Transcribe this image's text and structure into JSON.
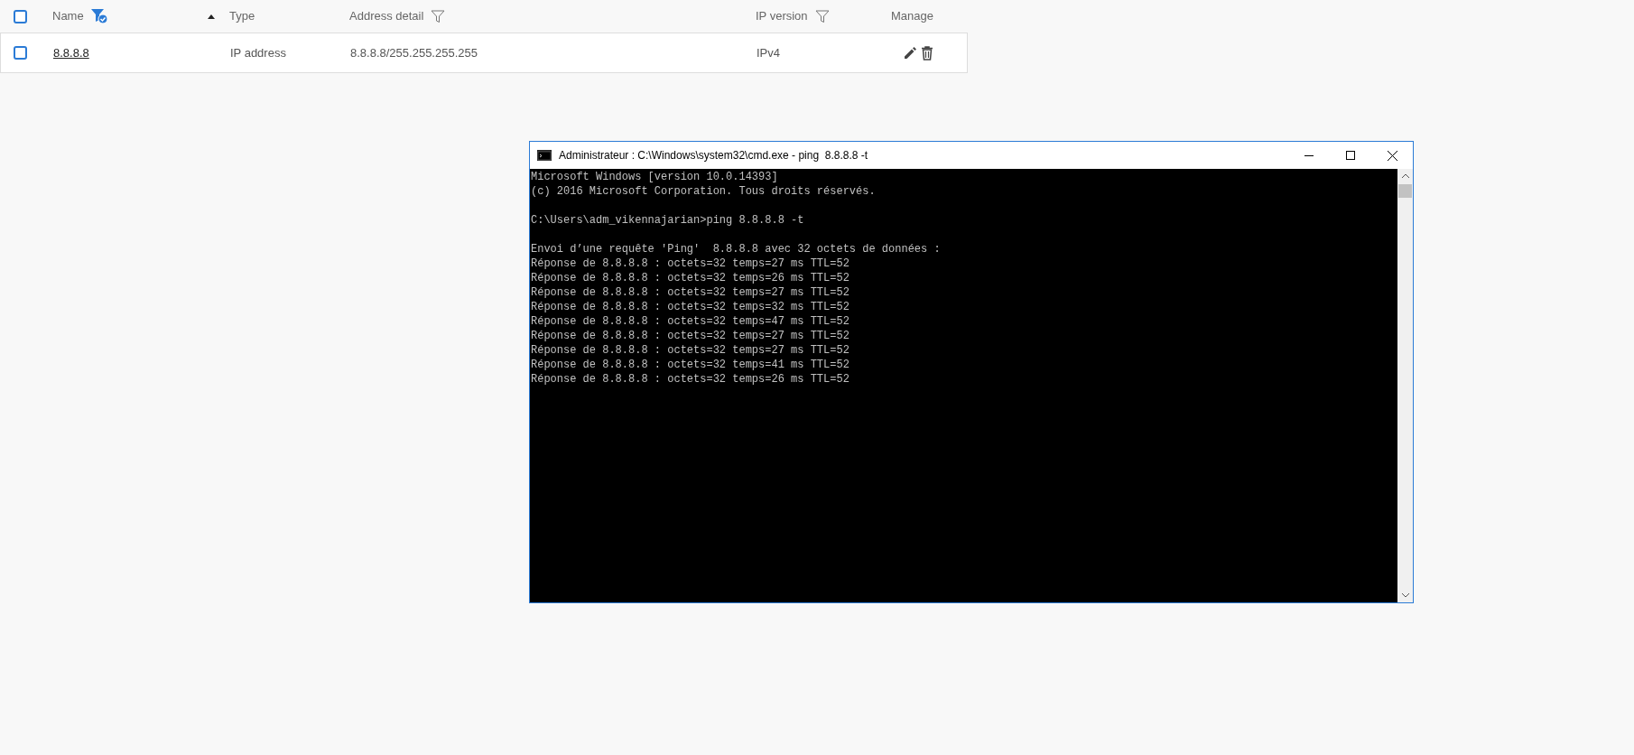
{
  "table": {
    "select_all": {
      "checked": false
    },
    "columns": [
      {
        "label": "Name",
        "filterable": true,
        "filter_active": true,
        "sorted": true
      },
      {
        "label": "Type",
        "filterable": false,
        "sorted": false
      },
      {
        "label": "Address detail",
        "filterable": true,
        "filter_active": false,
        "sorted": false
      },
      {
        "label": "IP version",
        "filterable": true,
        "filter_active": false,
        "sorted": false
      },
      {
        "label": "Manage",
        "filterable": false,
        "sorted": false
      }
    ],
    "rows": [
      {
        "checked": false,
        "name": "8.8.8.8",
        "type": "IP address",
        "address_detail": "8.8.8.8/255.255.255.255",
        "ip_version": "IPv4"
      }
    ]
  },
  "console_window": {
    "title": "Administrateur : C:\\Windows\\system32\\cmd.exe - ping  8.8.8.8 -t",
    "blocks": [
      [
        "Microsoft Windows [version 10.0.14393]",
        "(c) 2016 Microsoft Corporation. Tous droits réservés."
      ],
      [
        "C:\\Users\\adm_vikennajarian>ping 8.8.8.8 -t"
      ],
      [
        "Envoi d’une requête 'Ping'  8.8.8.8 avec 32 octets de données :",
        "Réponse de 8.8.8.8 : octets=32 temps=27 ms TTL=52",
        "Réponse de 8.8.8.8 : octets=32 temps=26 ms TTL=52",
        "Réponse de 8.8.8.8 : octets=32 temps=27 ms TTL=52",
        "Réponse de 8.8.8.8 : octets=32 temps=32 ms TTL=52",
        "Réponse de 8.8.8.8 : octets=32 temps=47 ms TTL=52",
        "Réponse de 8.8.8.8 : octets=32 temps=27 ms TTL=52",
        "Réponse de 8.8.8.8 : octets=32 temps=27 ms TTL=52",
        "Réponse de 8.8.8.8 : octets=32 temps=41 ms TTL=52",
        "Réponse de 8.8.8.8 : octets=32 temps=26 ms TTL=52"
      ]
    ]
  }
}
